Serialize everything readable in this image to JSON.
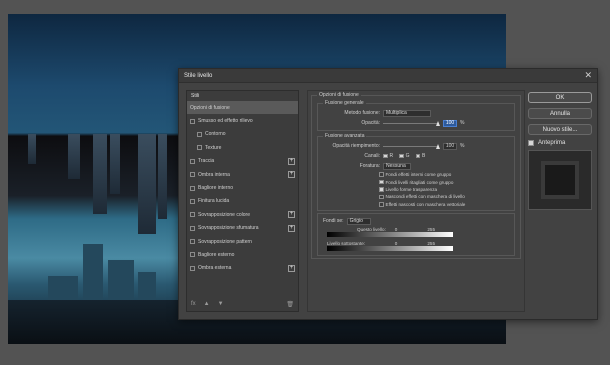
{
  "dialog": {
    "title": "Stile livello",
    "close_glyph": "✕"
  },
  "left_panel": {
    "header": "Stili",
    "items": [
      {
        "label": "Opzioni di fusione",
        "checkbox": false,
        "plus": false,
        "selected": true,
        "indent": false
      },
      {
        "label": "Smusso ed effetto rilievo",
        "checkbox": true,
        "plus": false,
        "selected": false,
        "indent": false
      },
      {
        "label": "Contorno",
        "checkbox": true,
        "plus": false,
        "selected": false,
        "indent": true
      },
      {
        "label": "Texture",
        "checkbox": true,
        "plus": false,
        "selected": false,
        "indent": true
      },
      {
        "label": "Traccia",
        "checkbox": true,
        "plus": true,
        "selected": false,
        "indent": false
      },
      {
        "label": "Ombra interna",
        "checkbox": true,
        "plus": true,
        "selected": false,
        "indent": false
      },
      {
        "label": "Bagliore interno",
        "checkbox": true,
        "plus": false,
        "selected": false,
        "indent": false
      },
      {
        "label": "Finitura lucida",
        "checkbox": true,
        "plus": false,
        "selected": false,
        "indent": false
      },
      {
        "label": "Sovrapposizione colore",
        "checkbox": true,
        "plus": true,
        "selected": false,
        "indent": false
      },
      {
        "label": "Sovrapposizione sfumatura",
        "checkbox": true,
        "plus": true,
        "selected": false,
        "indent": false
      },
      {
        "label": "Sovrapposizione pattern",
        "checkbox": true,
        "plus": false,
        "selected": false,
        "indent": false
      },
      {
        "label": "Bagliore esterno",
        "checkbox": true,
        "plus": false,
        "selected": false,
        "indent": false
      },
      {
        "label": "Ombra esterna",
        "checkbox": true,
        "plus": true,
        "selected": false,
        "indent": false
      }
    ],
    "footer": {
      "fx": "fx",
      "up": "▲",
      "down": "▼",
      "trash": "🗑"
    }
  },
  "blending": {
    "legend": "Opzioni di fusione",
    "general": {
      "title": "Fusione generale",
      "method_label": "Metodo fusione:",
      "method_value": "Multiplica",
      "opacity_label": "Opacità:",
      "opacity_value": "100",
      "opacity_unit": "%",
      "opacity_fraction": 1.0
    },
    "advanced": {
      "title": "Fusione avanzata",
      "fill_label": "Opacità riempimento:",
      "fill_value": "100",
      "fill_unit": "%",
      "fill_fraction": 1.0,
      "channels_label": "Canali:",
      "channels": [
        "R",
        "G",
        "B"
      ],
      "knockout_label": "Foratura:",
      "knockout_value": "Nessuna",
      "options": [
        {
          "label": "Fondi effetti interni come gruppo",
          "checked": false
        },
        {
          "label": "Fondi livelli ritagliati come gruppo",
          "checked": true
        },
        {
          "label": "Livello forme trasparenza",
          "checked": true
        },
        {
          "label": "Nascondi effetti con maschera di livello",
          "checked": false
        },
        {
          "label": "Effetti nascosti con maschera vettoriale",
          "checked": false
        }
      ]
    },
    "blend_if": {
      "label": "Fondi se:",
      "value": "Grigio",
      "this_layer_label": "Questo livello:",
      "this_low": "0",
      "this_high": "255",
      "under_layer_label": "Livello sottostante:",
      "under_low": "0",
      "under_high": "255"
    }
  },
  "buttons": {
    "ok": "OK",
    "cancel": "Annulla",
    "new_style": "Nuovo stile...",
    "preview_label": "Anteprima"
  },
  "colors": {
    "dialog_bg": "#424242",
    "accent": "#2d5a9c"
  }
}
